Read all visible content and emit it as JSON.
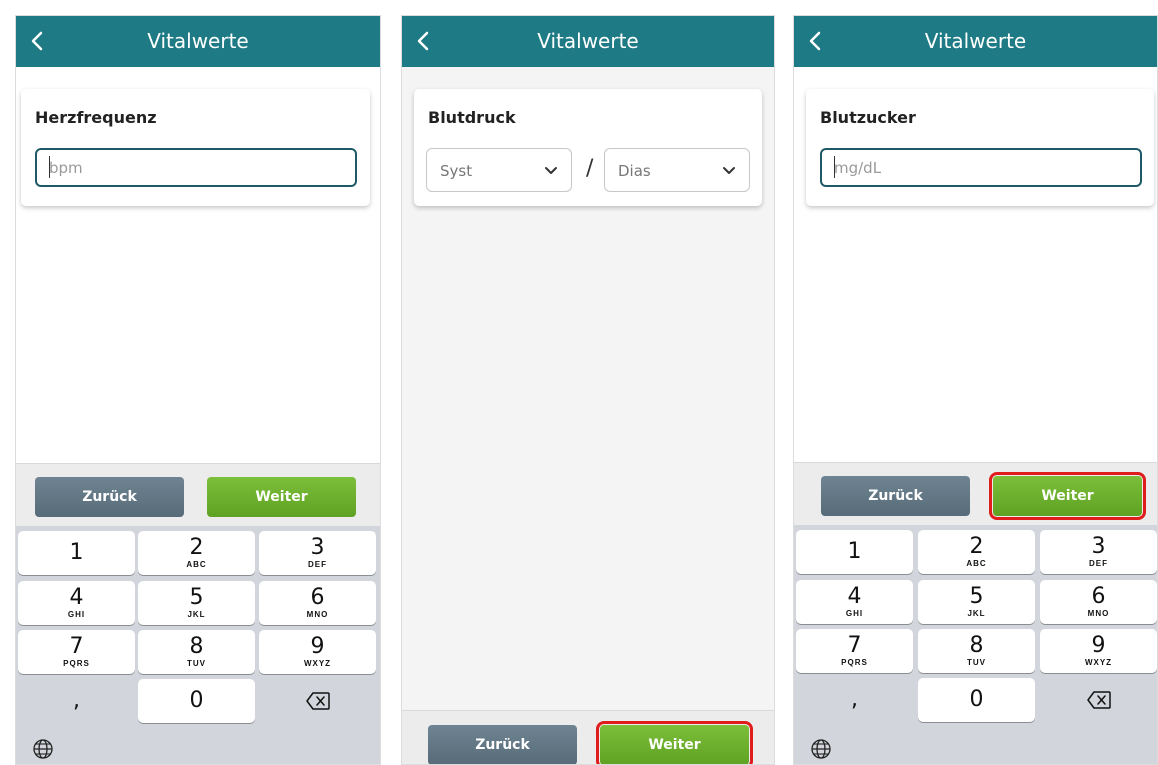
{
  "header_title": "Vitalwerte",
  "colors": {
    "header": "#1e7b85",
    "back_button": "#5f7381",
    "next_button": "#6cae2d",
    "highlight": "#e01d1d"
  },
  "icons": {
    "back": "chevron-left-icon",
    "dropdown": "chevron-down-icon",
    "delete": "backspace-icon",
    "globe": "globe-icon"
  },
  "screens": [
    {
      "card_label": "Herzfrequenz",
      "input_placeholder": "bpm",
      "buttons": {
        "back": "Zurück",
        "next": "Weiter"
      }
    },
    {
      "card_label": "Blutdruck",
      "selects": [
        {
          "selected": "Syst"
        },
        {
          "selected": "Dias"
        }
      ],
      "separator": "/",
      "buttons": {
        "back": "Zurück",
        "next": "Weiter"
      }
    },
    {
      "card_label": "Blutzucker",
      "input_placeholder": "mg/dL",
      "buttons": {
        "back": "Zurück",
        "next": "Weiter"
      }
    }
  ],
  "keypad": {
    "keys": [
      {
        "digit": "1",
        "letters": ""
      },
      {
        "digit": "2",
        "letters": "ABC"
      },
      {
        "digit": "3",
        "letters": "DEF"
      },
      {
        "digit": "4",
        "letters": "GHI"
      },
      {
        "digit": "5",
        "letters": "JKL"
      },
      {
        "digit": "6",
        "letters": "MNO"
      },
      {
        "digit": "7",
        "letters": "PQRS"
      },
      {
        "digit": "8",
        "letters": "TUV"
      },
      {
        "digit": "9",
        "letters": "WXYZ"
      },
      {
        "digit": ",",
        "letters": ""
      },
      {
        "digit": "0",
        "letters": ""
      }
    ]
  }
}
